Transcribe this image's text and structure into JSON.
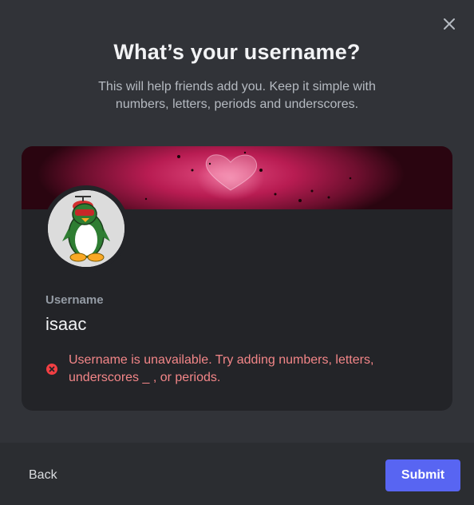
{
  "modal": {
    "title": "What’s your username?",
    "subtitle": "This will help friends add you. Keep it simple with numbers, letters, periods and underscores."
  },
  "profile_card": {
    "banner_description": "pink heart banner",
    "avatar_description": "green penguin with propeller hat",
    "field_label": "Username",
    "username_value": "isaac",
    "error_message": "Username is unavailable. Try adding numbers, letters, underscores _ , or periods."
  },
  "footer": {
    "back_label": "Back",
    "submit_label": "Submit"
  },
  "colors": {
    "background": "#313338",
    "footer_background": "#2b2d31",
    "card_background": "#232428",
    "accent": "#5865f2",
    "error": "#f38688"
  },
  "icons": {
    "close": "close-icon",
    "error": "error-circle-icon"
  }
}
